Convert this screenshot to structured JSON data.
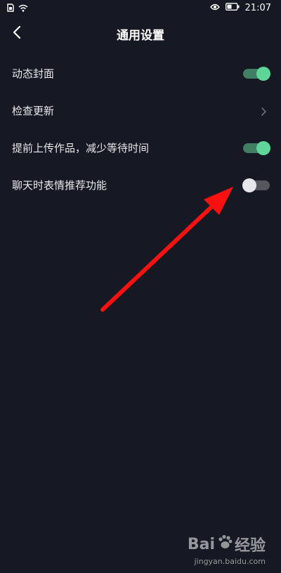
{
  "status_bar": {
    "time": "21:07"
  },
  "header": {
    "title": "通用设置",
    "back_icon": "chevron-left-icon"
  },
  "settings": [
    {
      "label": "动态封面",
      "control": "toggle",
      "enabled": true
    },
    {
      "label": "检查更新",
      "control": "chevron",
      "enabled": null
    },
    {
      "label": "提前上传作品，减少等待时间",
      "control": "toggle",
      "enabled": true
    },
    {
      "label": "聊天时表情推荐功能",
      "control": "toggle",
      "enabled": false
    }
  ],
  "colors": {
    "background": "#161823",
    "toggle_on_track": "#3f7f63",
    "toggle_on_knob": "#5fd59a",
    "toggle_off_track": "#55565e",
    "toggle_off_knob": "#e6e6ea",
    "annotation_arrow": "#ff1010"
  },
  "watermark": {
    "brand_left": "Bai",
    "brand_right": "经验",
    "url": "jingyan.baidu.com"
  }
}
